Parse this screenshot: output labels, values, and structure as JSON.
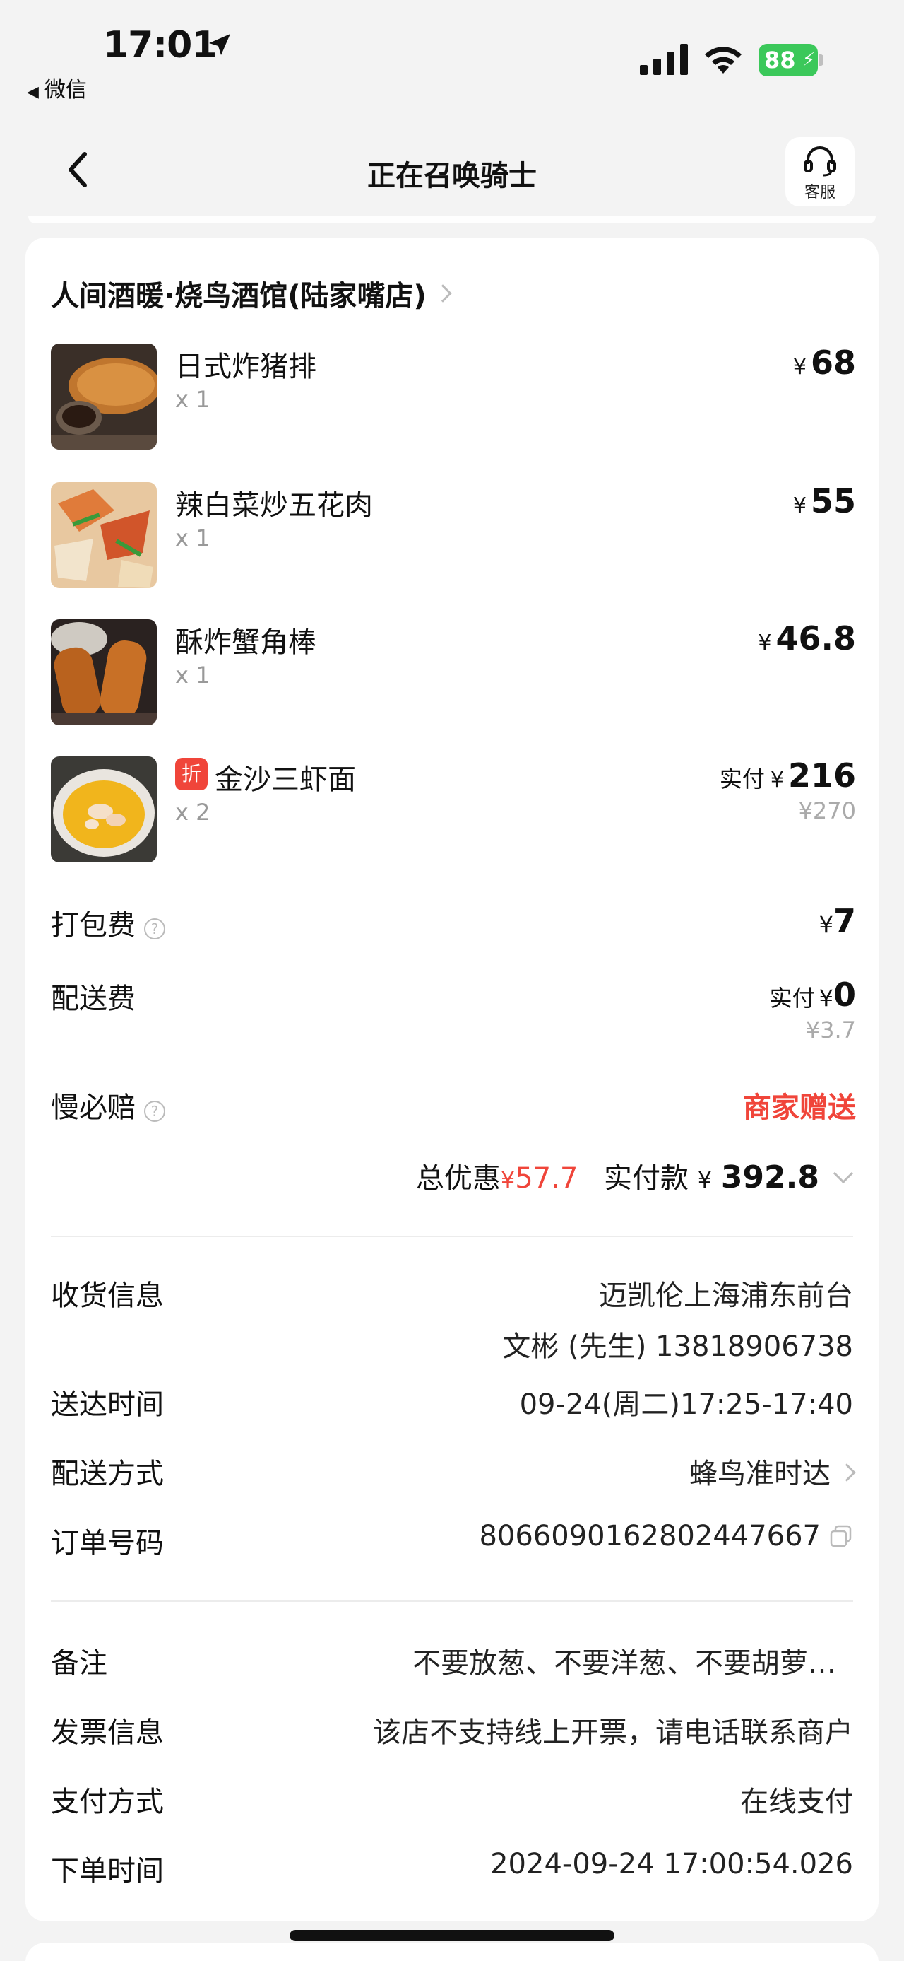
{
  "status_bar": {
    "time": "17:01",
    "back_app": "微信",
    "battery": "88",
    "colors": {
      "battery": "#3bc85a"
    }
  },
  "nav": {
    "title": "正在召唤骑士",
    "cs_label": "客服"
  },
  "shop": {
    "name": "人间酒暖·烧鸟酒馆(陆家嘴店)"
  },
  "items": [
    {
      "name": "日式炸猪排",
      "qty": "x 1",
      "yen": "¥",
      "price": "68"
    },
    {
      "name": "辣白菜炒五花肉",
      "qty": "x 1",
      "yen": "¥",
      "price": "55"
    },
    {
      "name": "酥炸蟹角棒",
      "qty": "x 1",
      "yen": "¥",
      "price": "46.8"
    },
    {
      "name": "金沙三虾面",
      "tag": "折",
      "qty": "x 2",
      "paid_label": "实付",
      "yen": "¥",
      "price": "216",
      "original": "¥270"
    }
  ],
  "fees": {
    "packing": {
      "label": "打包费",
      "help": "?",
      "yen": "¥",
      "value": "7"
    },
    "delivery": {
      "label": "配送费",
      "paid_label": "实付",
      "yen": "¥",
      "value": "0",
      "original": "¥3.7"
    },
    "late_comp": {
      "label": "慢必赔",
      "help": "?",
      "value": "商家赠送"
    }
  },
  "summary": {
    "discount_label": "总优惠",
    "discount_yen": "¥",
    "discount_value": "57.7",
    "paid_label": "实付款",
    "paid_yen": "¥",
    "paid_value": "392.8",
    "accent_color": "#f0453a"
  },
  "delivery_info": {
    "address_label": "收货信息",
    "address_line1": "迈凯伦上海浦东前台",
    "address_line2": "文彬 (先生) 13818906738",
    "time_label": "送达时间",
    "time_value": "09-24(周二)17:25-17:40",
    "method_label": "配送方式",
    "method_value": "蜂鸟准时达",
    "order_label": "订单号码",
    "order_value": "8066090162802447667"
  },
  "order_info": {
    "remark_label": "备注",
    "remark_value": "不要放葱、不要洋葱、不要胡萝…",
    "invoice_label": "发票信息",
    "invoice_value": "该店不支持线上开票，请电话联系商户",
    "payment_label": "支付方式",
    "payment_value": "在线支付",
    "placed_label": "下单时间",
    "placed_value": "2024-09-24 17:00:54.026"
  }
}
